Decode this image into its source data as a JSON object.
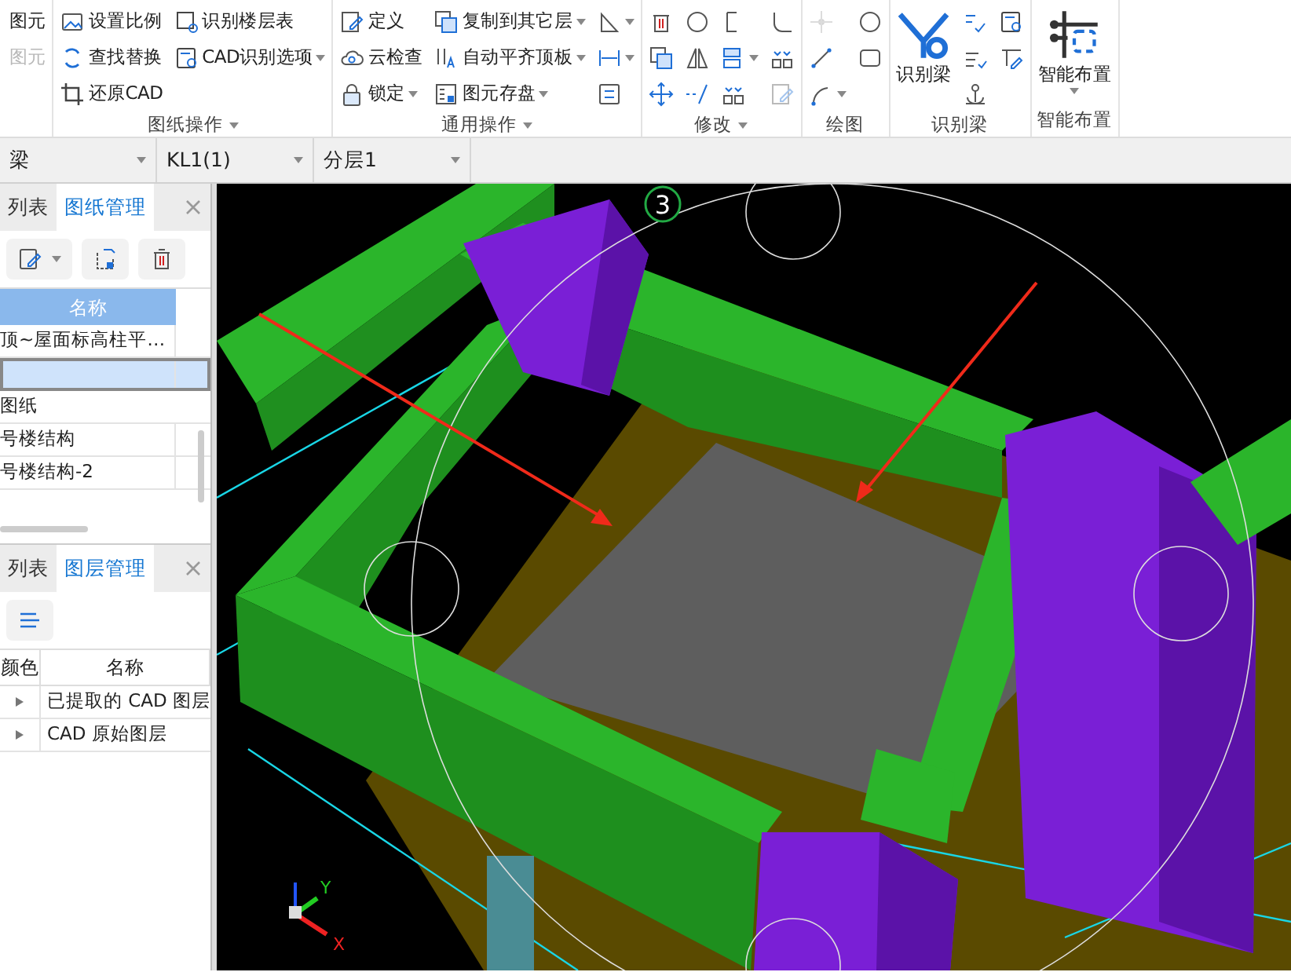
{
  "ribbon": {
    "groups": [
      {
        "columns": [
          [
            {
              "label": "图元",
              "kind": "plain",
              "dropdown": false,
              "disabled": false
            },
            {
              "label": "图元",
              "kind": "plain",
              "dropdown": false,
              "disabled": true
            }
          ]
        ]
      },
      {
        "label": "图纸操作",
        "label_dropdown": true,
        "columns": [
          [
            {
              "label": "设置比例",
              "kind": "frame",
              "dropdown": false,
              "disabled": false
            },
            {
              "label": "查找替换",
              "kind": "refresh",
              "dropdown": false,
              "disabled": false
            },
            {
              "label": "还原CAD",
              "kind": "crop",
              "dropdown": false,
              "disabled": false
            }
          ],
          [
            {
              "label": "识别楼层表",
              "kind": "tablesearch",
              "dropdown": false,
              "disabled": false
            },
            {
              "label": "CAD识别选项",
              "kind": "docsearch",
              "dropdown": true,
              "disabled": false
            }
          ]
        ]
      },
      {
        "label": "通用操作",
        "label_dropdown": true,
        "columns": [
          [
            {
              "label": "定义",
              "kind": "edit",
              "dropdown": false,
              "disabled": false
            },
            {
              "label": "云检查",
              "kind": "cloud",
              "dropdown": false,
              "disabled": false
            },
            {
              "label": "锁定",
              "kind": "lock",
              "dropdown": true,
              "disabled": false
            }
          ],
          [
            {
              "label": "复制到其它层",
              "kind": "copy",
              "dropdown": true,
              "disabled": false
            },
            {
              "label": "自动平齐顶板",
              "kind": "align",
              "dropdown": true,
              "disabled": false
            },
            {
              "label": "图元存盘",
              "kind": "disk",
              "dropdown": true,
              "disabled": false
            }
          ],
          [
            {
              "kind": "triangle",
              "dropdown": true,
              "disabled": false
            },
            {
              "kind": "dimension",
              "dropdown": true,
              "disabled": false
            },
            {
              "kind": "swap",
              "dropdown": false,
              "disabled": false
            }
          ]
        ]
      },
      {
        "label": "修改",
        "label_dropdown": true,
        "columns": [
          [
            {
              "kind": "trash",
              "dropdown": false,
              "disabled": false
            },
            {
              "kind": "copy",
              "dropdown": false,
              "disabled": false
            },
            {
              "kind": "move",
              "dropdown": false,
              "disabled": false
            }
          ],
          [
            {
              "kind": "circle",
              "dropdown": false,
              "disabled": false
            },
            {
              "kind": "mirror",
              "dropdown": false,
              "disabled": false
            },
            {
              "kind": "dashline",
              "dropdown": false,
              "disabled": false
            }
          ],
          [
            {
              "kind": "offset",
              "dropdown": false,
              "disabled": false
            },
            {
              "kind": "stack",
              "dropdown": true,
              "disabled": false
            },
            {
              "kind": "split",
              "dropdown": false,
              "disabled": false
            }
          ],
          [
            {
              "kind": "fillet",
              "dropdown": false,
              "disabled": false
            },
            {
              "kind": "split",
              "dropdown": false,
              "disabled": false
            },
            {
              "kind": "edit",
              "dropdown": false,
              "disabled": true
            }
          ]
        ]
      },
      {
        "label": "绘图",
        "columns": [
          [
            {
              "kind": "point",
              "dropdown": false,
              "disabled": true
            },
            {
              "kind": "line",
              "dropdown": false,
              "disabled": false
            },
            {
              "kind": "arc",
              "dropdown": true,
              "disabled": false
            }
          ],
          [
            {
              "kind": "circle",
              "dropdown": false,
              "disabled": false
            },
            {
              "kind": "rect",
              "dropdown": false,
              "disabled": false
            }
          ]
        ]
      },
      {
        "label": "识别梁",
        "large": {
          "label": "识别梁",
          "kind": "filtersearch",
          "dropdown": false
        },
        "columns": [
          [
            {
              "kind": "check",
              "dropdown": false,
              "disabled": false
            },
            {
              "kind": "sort",
              "dropdown": false,
              "disabled": false
            },
            {
              "kind": "anchor",
              "dropdown": false,
              "disabled": false
            }
          ],
          [
            {
              "kind": "docsearch",
              "dropdown": false,
              "disabled": false
            },
            {
              "kind": "pen",
              "dropdown": false,
              "disabled": false
            }
          ]
        ]
      },
      {
        "label": "智能布置",
        "large": {
          "label": "智能布置",
          "kind": "grid",
          "dropdown": true
        }
      }
    ]
  },
  "selectors": [
    {
      "value": "梁"
    },
    {
      "value": "KL1(1)"
    },
    {
      "value": "分层1"
    }
  ],
  "drawing_panel": {
    "tabs": [
      {
        "label": "列表",
        "selected": false
      },
      {
        "label": "图纸管理",
        "selected": true
      }
    ],
    "columns": [
      "名称"
    ],
    "rows": [
      {
        "kind": "file",
        "name": "顶~屋面标高柱平…",
        "selected": false
      },
      {
        "kind": "file",
        "selected": true
      },
      {
        "kind": "group",
        "name": "图纸",
        "selected": false
      },
      {
        "kind": "file",
        "name": "号楼结构",
        "selected": false
      },
      {
        "kind": "file",
        "name": "号楼结构-2",
        "selected": false
      }
    ]
  },
  "layer_panel": {
    "tabs": [
      {
        "label": "列表",
        "selected": false
      },
      {
        "label": "图层管理",
        "selected": true
      }
    ],
    "columns": [
      "颜色",
      "名称"
    ],
    "rows": [
      {
        "name": "已提取的 CAD 图层",
        "expanded": false
      },
      {
        "name": "CAD 原始图层",
        "expanded": false
      }
    ]
  },
  "viewport": {
    "axis_number": "3",
    "axes": [
      {
        "label": "Y",
        "color": "#22cc22"
      },
      {
        "label": "X",
        "color": "#ee2222"
      }
    ]
  }
}
